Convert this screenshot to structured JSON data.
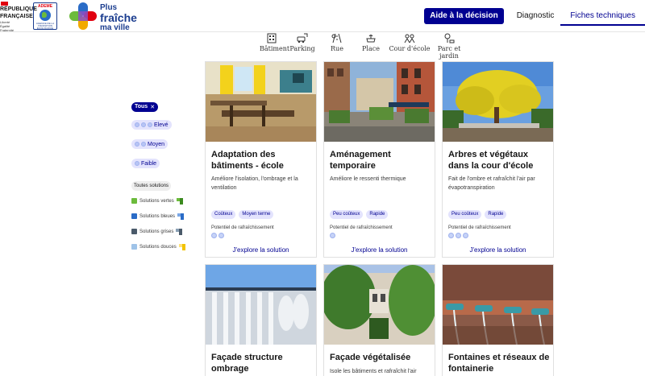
{
  "header": {
    "republic": [
      "RÉPUBLIQUE",
      "FRANÇAISE"
    ],
    "motto": [
      "Liberté",
      "Égalité",
      "Fraternité"
    ],
    "ademe_name": "ADEME",
    "ademe_sub": "AGENCE DE LA TRANSITION ÉCOLOGIQUE",
    "site_name": [
      "Plus",
      "fraîche",
      "ma ville"
    ],
    "nav": {
      "cta": "Aide à la décision",
      "items": [
        "Diagnostic",
        "Fiches techniques"
      ],
      "active_index": 1
    }
  },
  "categories": [
    {
      "label": "Bâtiment",
      "icon": "building-icon"
    },
    {
      "label": "Parking",
      "icon": "parking-icon"
    },
    {
      "label": "Rue",
      "icon": "street-icon"
    },
    {
      "label": "Place",
      "icon": "fountain-icon"
    },
    {
      "label": "Cour d'école",
      "icon": "school-yard-icon"
    },
    {
      "label": "Parc et jardin",
      "icon": "park-icon"
    }
  ],
  "filters": {
    "all_chip": "Tous",
    "levels": [
      {
        "label": "Elevé",
        "dots": 3
      },
      {
        "label": "Moyen",
        "dots": 2
      },
      {
        "label": "Faible",
        "dots": 1
      }
    ],
    "all_solutions": "Toutes solutions",
    "solutions": [
      {
        "label": "Solutions vertes",
        "color": "#6cbb3c"
      },
      {
        "label": "Solutions bleues",
        "color": "#2a6cc7"
      },
      {
        "label": "Solutions grises",
        "color": "#4a5a6a"
      },
      {
        "label": "Solutions douces",
        "color": "#f2c300"
      }
    ]
  },
  "cards": [
    {
      "title": "Adaptation des bâtiments - école",
      "desc": "Améliore l'isolation, l'ombrage et la ventilation",
      "tags": [
        "Coûteux",
        "Moyen terme"
      ],
      "potential_label": "Potentiel de rafraîchissement",
      "potential": 2,
      "link": "J'explore la solution"
    },
    {
      "title": "Aménagement temporaire",
      "desc": "Améliore le ressenti thermique",
      "tags": [
        "Peu coûteux",
        "Rapide"
      ],
      "potential_label": "Potentiel de rafraîchissement",
      "potential": 1,
      "link": "J'explore la solution"
    },
    {
      "title": "Arbres et végétaux dans la cour d'école",
      "desc": "Fait de l'ombre et rafraîchit l'air par évapotranspiration",
      "tags": [
        "Peu coûteux",
        "Rapide"
      ],
      "potential_label": "Potentiel de rafraîchissement",
      "potential": 3,
      "link": "J'explore la solution"
    },
    {
      "title": "Façade structure ombrage",
      "desc": "",
      "tags": [],
      "potential": 0
    },
    {
      "title": "Façade végétalisée",
      "desc": "Isole les bâtiments et rafraîchit l'air",
      "tags": [],
      "potential": 0
    },
    {
      "title": "Fontaines et réseaux de fontainerie",
      "desc": "",
      "tags": [],
      "potential": 0
    }
  ]
}
